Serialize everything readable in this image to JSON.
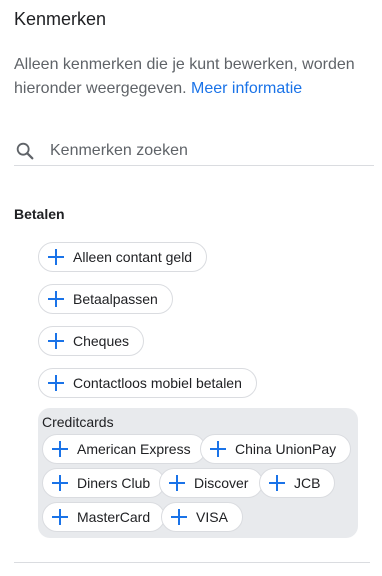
{
  "header": {
    "title": "Kenmerken"
  },
  "description": {
    "text": "Alleen kenmerken die je kunt bewerken, worden hieronder weergegeven.",
    "link": "Meer informatie"
  },
  "search": {
    "placeholder": "Kenmerken zoeken",
    "value": ""
  },
  "section": {
    "title": "Betalen",
    "options": [
      {
        "label": "Alleen contant geld"
      },
      {
        "label": "Betaalpassen"
      },
      {
        "label": "Cheques"
      },
      {
        "label": "Contactloos mobiel betalen"
      }
    ],
    "group": {
      "title": "Creditcards",
      "options": [
        {
          "label": "American Express"
        },
        {
          "label": "China UnionPay"
        },
        {
          "label": "Diners Club"
        },
        {
          "label": "Discover"
        },
        {
          "label": "JCB"
        },
        {
          "label": "MasterCard"
        },
        {
          "label": "VISA"
        }
      ]
    }
  },
  "icons": {
    "search": "search-icon",
    "add": "plus-icon"
  },
  "colors": {
    "accent": "#1a73e8",
    "group_bg": "#e8eaed",
    "border": "#dadce0"
  }
}
